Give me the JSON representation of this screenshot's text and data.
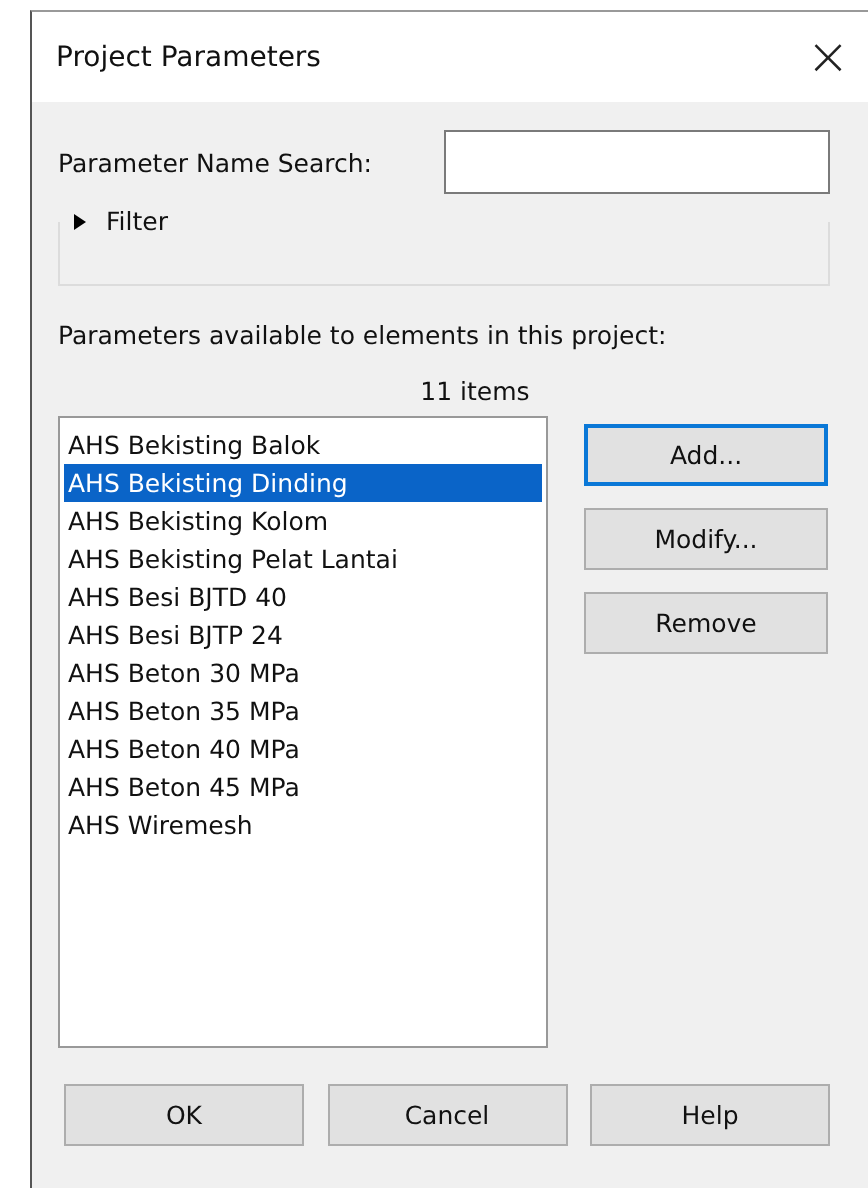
{
  "window": {
    "title": "Project Parameters",
    "close": "×"
  },
  "search": {
    "label": "Parameter Name Search:"
  },
  "filter": {
    "label": "Filter",
    "expanded": false
  },
  "list": {
    "caption": "Parameters available to elements in this project:",
    "count": "11 items",
    "items": [
      {
        "label": "AHS Bekisting Balok",
        "selected": false
      },
      {
        "label": "AHS Bekisting Dinding",
        "selected": true
      },
      {
        "label": "AHS Bekisting Kolom",
        "selected": false
      },
      {
        "label": "AHS Bekisting Pelat Lantai",
        "selected": false
      },
      {
        "label": "AHS Besi BJTD 40",
        "selected": false
      },
      {
        "label": "AHS Besi BJTP 24",
        "selected": false
      },
      {
        "label": "AHS Beton 30 MPa",
        "selected": false
      },
      {
        "label": "AHS Beton 35 MPa",
        "selected": false
      },
      {
        "label": "AHS Beton 40 MPa",
        "selected": false
      },
      {
        "label": "AHS Beton 45 MPa",
        "selected": false
      },
      {
        "label": "AHS Wiremesh",
        "selected": false
      }
    ]
  },
  "side_buttons": [
    {
      "label": "Add...",
      "focused": true
    },
    {
      "label": "Modify...",
      "focused": false
    },
    {
      "label": "Remove",
      "focused": false
    }
  ],
  "buttons": [
    "OK",
    "Cancel",
    "Help"
  ]
}
